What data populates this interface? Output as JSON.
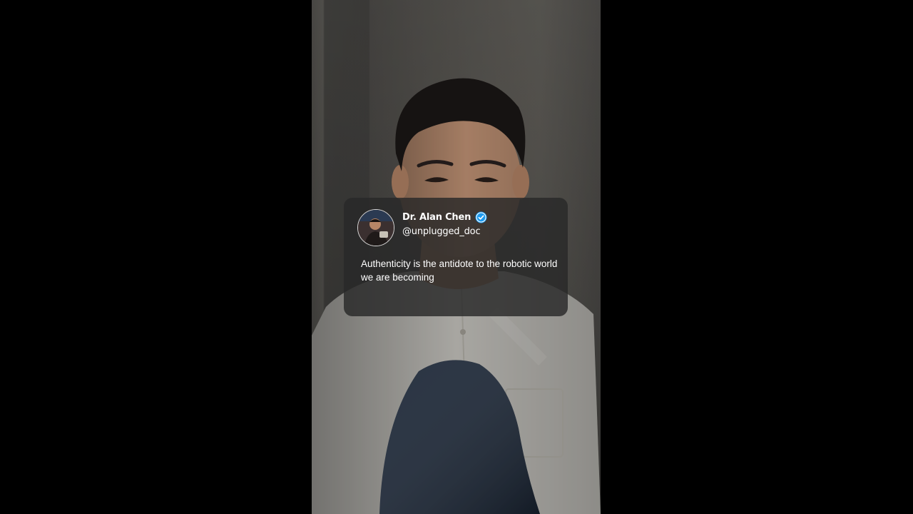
{
  "post": {
    "display_name": "Dr. Alan Chen",
    "handle": "@unplugged_doc",
    "text": "Authenticity is the antidote to the robotic world we are becoming",
    "verified": true,
    "verified_badge_icon": "verified-check-icon",
    "badge_color": "#1d9bf0"
  },
  "colors": {
    "letterbox": "#000000",
    "card_background": "rgba(40,40,40,0.82)",
    "text": "#ffffff"
  }
}
